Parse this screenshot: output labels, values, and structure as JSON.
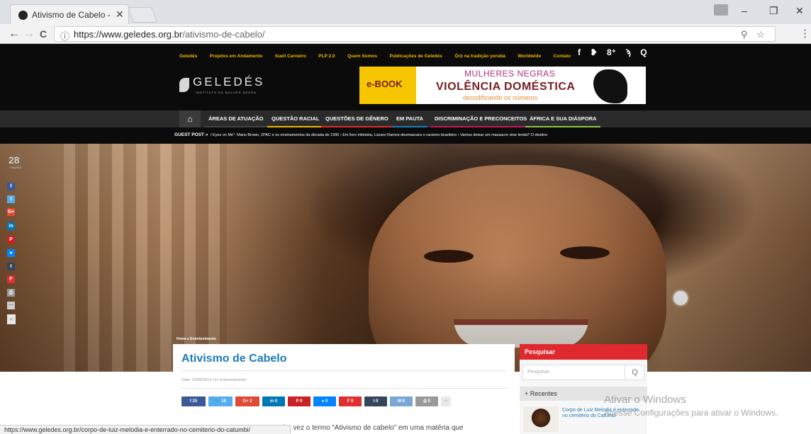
{
  "browser": {
    "tab_title": "Ativismo de Cabelo - Gel",
    "tab_close": "✕",
    "url_host": "https://www.geledes.org.br",
    "url_path": "/ativismo-de-cabelo/",
    "info_icon": "ⓘ",
    "status_url": "https://www.geledes.org.br/corpo-de-luiz-melodia-e-enterrado-no-cemiterio-do-catumbi/",
    "controls": {
      "minimize": "–",
      "restore": "❐",
      "close": "✕"
    },
    "nav": {
      "back": "←",
      "forward": "→",
      "reload": "C",
      "zoom": "⚲",
      "star": "☆",
      "menu": "⋮"
    }
  },
  "topnav": {
    "links": [
      "Geledés",
      "Projetos em Andamento",
      "Sueli Carneiro",
      "PLP 2.0",
      "Quem Somos",
      "Publicações de Geledés",
      "Ọ̀rọ̀ na tradição yorubá",
      "Worldwide",
      "Contato"
    ],
    "social": [
      "f",
      "🐦",
      "g+",
      "rss",
      "search"
    ],
    "social_glyphs": [
      "f",
      "❥",
      "8⁺",
      "ϡ",
      "Q"
    ]
  },
  "header": {
    "logo_text": "GELEDÉS",
    "logo_sub": "INSTITUTO DA MULHER NEGRA",
    "banner": {
      "ebook": "e-BOOK",
      "line1": "MULHERES NEGRAS",
      "line2": "VIOLÊNCIA DOMÉSTICA",
      "line3": "decodificando os números"
    }
  },
  "mainnav": {
    "home_icon": "home-icon",
    "home_glyph": "⌂",
    "items": [
      {
        "label": "ÁREAS DE ATUAÇÃO",
        "color": "#444444"
      },
      {
        "label": "QUESTÃO RACIAL",
        "color": "#f0b500"
      },
      {
        "label": "QUESTÕES DE GÊNERO",
        "color": "#e0292e"
      },
      {
        "label": "EM PAUTA",
        "color": "#1e7bb7"
      },
      {
        "label": "DISCRIMINAÇÃO E PRECONCEITOS",
        "color": "#c2185b"
      },
      {
        "label": "ÁFRICA E SUA DIÁSPORA",
        "color": "#8bc34a"
      }
    ]
  },
  "ticker": {
    "label": "GUEST POST »",
    "text": "I Eyez on Me\": Mano Brown, 2PAC e os ensinamentos da década de 1990     › Em livro intimista, Lázaro Ramos desmascara o racismo brasileiro     › Vamos deixar um massacre virar lenda? O destino"
  },
  "side_share": {
    "count": "28",
    "count_label": "SHARES",
    "buttons": [
      {
        "glyph": "f",
        "color": "#3b5998",
        "icon": "facebook-icon"
      },
      {
        "glyph": "t",
        "color": "#55acee",
        "icon": "twitter-icon"
      },
      {
        "glyph": "G+",
        "color": "#dd4b39",
        "icon": "google-plus-icon"
      },
      {
        "glyph": "in",
        "color": "#0077b5",
        "icon": "linkedin-icon"
      },
      {
        "glyph": "P",
        "color": "#cb2027",
        "icon": "pinterest-icon"
      },
      {
        "glyph": "●",
        "color": "#0084ff",
        "icon": "messenger-icon"
      },
      {
        "glyph": "t",
        "color": "#35465c",
        "icon": "tumblr-icon"
      },
      {
        "glyph": "F",
        "color": "#e02f2f",
        "icon": "flipboard-icon"
      },
      {
        "glyph": "⎙",
        "color": "#999999",
        "icon": "print-icon"
      },
      {
        "glyph": "···",
        "color": "#cccccc",
        "icon": "more-icon"
      }
    ],
    "collapse": "«"
  },
  "breadcrumb": "Home ▸ Entretenimento",
  "article": {
    "title": "Ativismo de Cabelo",
    "meta": "Date: 23/06/2014  |  in: Entretenimento",
    "body_visible": "eira vez o termo “Ativismo de cabelo” em uma matéria que",
    "share_buttons": [
      {
        "glyph": "f",
        "count": "25",
        "color": "#3b5998",
        "icon": "facebook-icon"
      },
      {
        "glyph": "🐦",
        "count": "10",
        "color": "#55acee",
        "icon": "twitter-icon"
      },
      {
        "glyph": "G+",
        "count": "2",
        "color": "#dd4b39",
        "icon": "google-plus-icon"
      },
      {
        "glyph": "in",
        "count": "0",
        "color": "#0077b5",
        "icon": "linkedin-icon"
      },
      {
        "glyph": "P",
        "count": "0",
        "color": "#cb2027",
        "icon": "pinterest-icon"
      },
      {
        "glyph": "●",
        "count": "0",
        "color": "#0084ff",
        "icon": "messenger-icon"
      },
      {
        "glyph": "F",
        "count": "0",
        "color": "#e02f2f",
        "icon": "flipboard-icon"
      },
      {
        "glyph": "t",
        "count": "0",
        "color": "#35465c",
        "icon": "tumblr-icon"
      },
      {
        "glyph": "✉",
        "count": "0",
        "color": "#7aa7d6",
        "icon": "email-icon"
      },
      {
        "glyph": "⎙",
        "count": "0",
        "color": "#999999",
        "icon": "print-icon"
      },
      {
        "glyph": "···",
        "count": "",
        "color": "#e8e8e8",
        "icon": "more-icon"
      }
    ]
  },
  "sidebar": {
    "heading": "Pesquisar",
    "search_placeholder": "Pesquisar",
    "search_glyph": "Q",
    "recent_tab": "+ Recentes",
    "recent_link": "Corpo de Luiz Melodia é enterrado no cemitério do Catumbi"
  },
  "watermark": {
    "line1": "Ativar o Windows",
    "line2": "Acesse Configurações para ativar o Windows."
  }
}
